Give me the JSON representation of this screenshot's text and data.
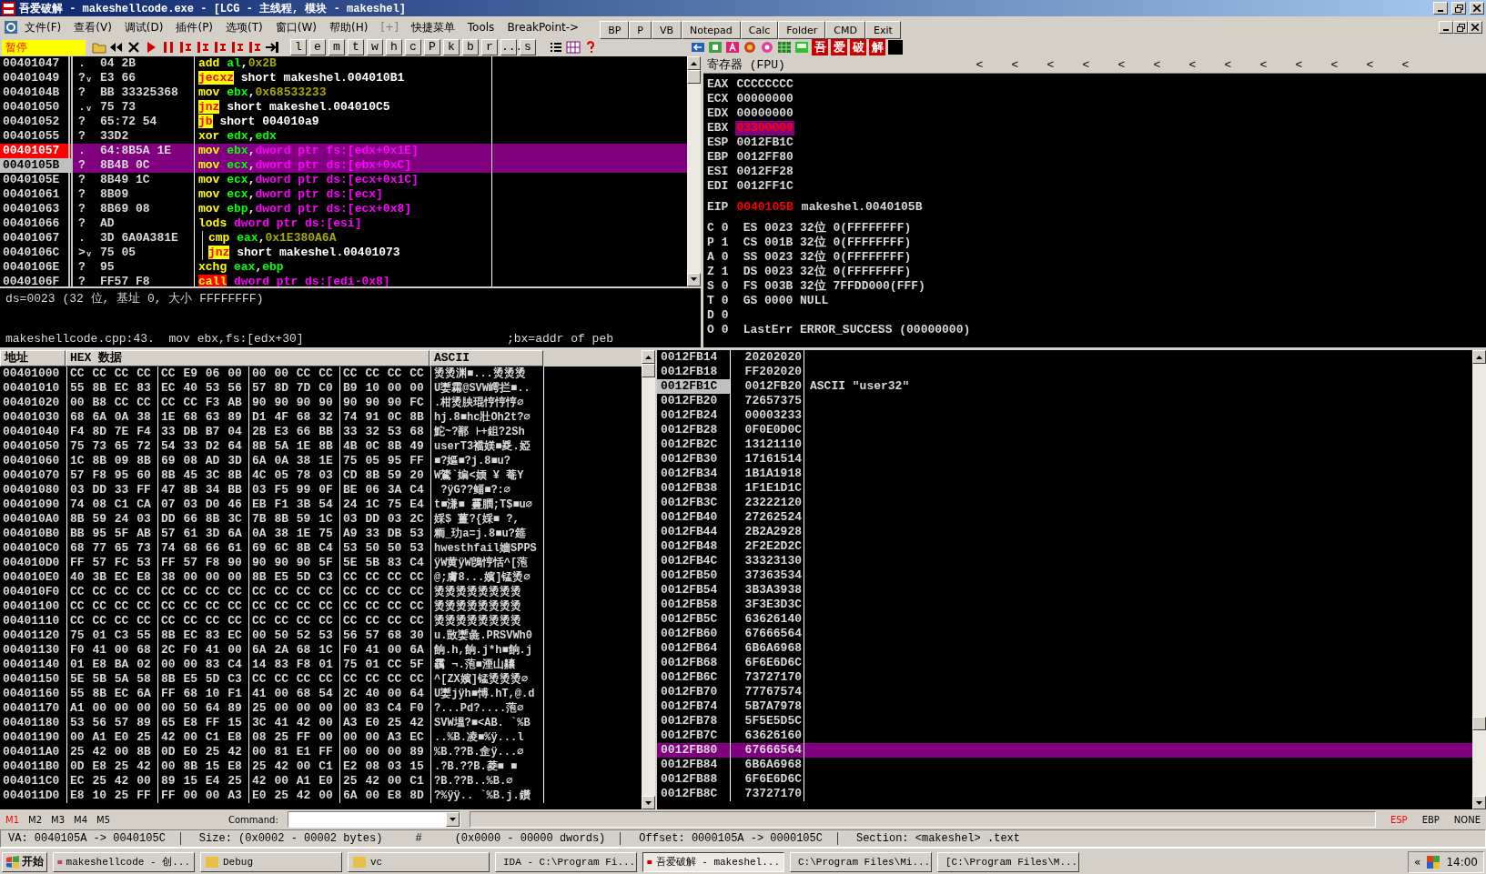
{
  "window": {
    "title": "吾爱破解 - makeshellcode.exe - [LCG - 主线程, 模块 - makeshel]"
  },
  "menu": [
    {
      "label": "文件(F)",
      "disabled": false
    },
    {
      "label": "查看(V)",
      "disabled": false
    },
    {
      "label": "调试(D)",
      "disabled": false
    },
    {
      "label": "插件(P)",
      "disabled": false
    },
    {
      "label": "选项(T)",
      "disabled": false
    },
    {
      "label": "窗口(W)",
      "disabled": false
    },
    {
      "label": "帮助(H)",
      "disabled": false
    },
    {
      "label": "[+]",
      "disabled": true
    },
    {
      "label": "快捷菜单",
      "disabled": false
    },
    {
      "label": "Tools",
      "disabled": false
    },
    {
      "label": "BreakPoint->",
      "disabled": false
    }
  ],
  "quick_buttons": [
    "BP",
    "P",
    "VB",
    "Notepad",
    "Calc",
    "Folder",
    "CMD",
    "Exit"
  ],
  "toolbar": {
    "status": "暂停",
    "letter_buttons": [
      "l",
      "e",
      "m",
      "t",
      "w",
      "h",
      "c",
      "P",
      "k",
      "b",
      "r",
      "...",
      "s"
    ],
    "plugin_chars": [
      "吾",
      "爱",
      "破",
      "解"
    ]
  },
  "disassembly": {
    "rows": [
      {
        "address": "00401047",
        "marker": ".",
        "hex": "04 2B",
        "ins": [
          {
            "kind": "mn",
            "text": "add "
          },
          {
            "kind": "reg",
            "text": "al"
          },
          {
            "kind": "pl",
            "text": ","
          },
          {
            "kind": "imm",
            "text": "0x2B"
          }
        ],
        "selected": false,
        "breakpoint": false,
        "current": false,
        "bracket": false
      },
      {
        "address": "00401049",
        "marker": "?ᵥ",
        "hex": "E3 66",
        "ins": [
          {
            "kind": "jmp",
            "text": "jecxz"
          },
          {
            "kind": "pl",
            "text": " short makeshel.004010B1"
          }
        ],
        "selected": false,
        "breakpoint": false,
        "current": false,
        "bracket": false
      },
      {
        "address": "0040104B",
        "marker": "?",
        "hex": "BB 33325368",
        "ins": [
          {
            "kind": "mn",
            "text": "mov "
          },
          {
            "kind": "reg",
            "text": "ebx"
          },
          {
            "kind": "pl",
            "text": ","
          },
          {
            "kind": "imm",
            "text": "0x68533233"
          }
        ],
        "selected": false,
        "breakpoint": false,
        "current": false,
        "bracket": false
      },
      {
        "address": "00401050",
        "marker": ".ᵥ",
        "hex": "75 73",
        "ins": [
          {
            "kind": "jmp",
            "text": "jnz"
          },
          {
            "kind": "pl",
            "text": " short makeshel.004010C5"
          }
        ],
        "selected": false,
        "breakpoint": false,
        "current": false,
        "bracket": false
      },
      {
        "address": "00401052",
        "marker": "?",
        "hex": "65:72 54",
        "ins": [
          {
            "kind": "jmp",
            "text": "jb"
          },
          {
            "kind": "pl",
            "text": " short 004010a9"
          }
        ],
        "selected": false,
        "breakpoint": false,
        "current": false,
        "bracket": false
      },
      {
        "address": "00401055",
        "marker": "?",
        "hex": "33D2",
        "ins": [
          {
            "kind": "mn",
            "text": "xor "
          },
          {
            "kind": "reg",
            "text": "edx"
          },
          {
            "kind": "pl",
            "text": ","
          },
          {
            "kind": "reg",
            "text": "edx"
          }
        ],
        "selected": false,
        "breakpoint": false,
        "current": false,
        "bracket": false
      },
      {
        "address": "00401057",
        "marker": ".",
        "hex": "64:8B5A 1E",
        "ins": [
          {
            "kind": "mn",
            "text": "mov "
          },
          {
            "kind": "reg",
            "text": "ebx"
          },
          {
            "kind": "pl",
            "text": ","
          },
          {
            "kind": "mem",
            "text": "dword ptr fs:[edx+0x1E]"
          }
        ],
        "selected": true,
        "breakpoint": true,
        "current": false,
        "bracket": false
      },
      {
        "address": "0040105B",
        "marker": "?",
        "hex": "8B4B 0C",
        "ins": [
          {
            "kind": "mn",
            "text": "mov "
          },
          {
            "kind": "reg",
            "text": "ecx"
          },
          {
            "kind": "pl",
            "text": ","
          },
          {
            "kind": "mem",
            "text": "dword ptr ds:[ebx+0xC]"
          }
        ],
        "selected": true,
        "breakpoint": false,
        "current": true,
        "bracket": false
      },
      {
        "address": "0040105E",
        "marker": "?",
        "hex": "8B49 1C",
        "ins": [
          {
            "kind": "mn",
            "text": "mov "
          },
          {
            "kind": "reg",
            "text": "ecx"
          },
          {
            "kind": "pl",
            "text": ","
          },
          {
            "kind": "mem",
            "text": "dword ptr ds:[ecx+0x1C]"
          }
        ],
        "selected": false,
        "breakpoint": false,
        "current": false,
        "bracket": false
      },
      {
        "address": "00401061",
        "marker": "?",
        "hex": "8B09",
        "ins": [
          {
            "kind": "mn",
            "text": "mov "
          },
          {
            "kind": "reg",
            "text": "ecx"
          },
          {
            "kind": "pl",
            "text": ","
          },
          {
            "kind": "mem",
            "text": "dword ptr ds:[ecx]"
          }
        ],
        "selected": false,
        "breakpoint": false,
        "current": false,
        "bracket": false
      },
      {
        "address": "00401063",
        "marker": "?",
        "hex": "8B69 08",
        "ins": [
          {
            "kind": "mn",
            "text": "mov "
          },
          {
            "kind": "reg",
            "text": "ebp"
          },
          {
            "kind": "pl",
            "text": ","
          },
          {
            "kind": "mem",
            "text": "dword ptr ds:[ecx+0x8]"
          }
        ],
        "selected": false,
        "breakpoint": false,
        "current": false,
        "bracket": false
      },
      {
        "address": "00401066",
        "marker": "?",
        "hex": "AD",
        "ins": [
          {
            "kind": "mn",
            "text": "lods "
          },
          {
            "kind": "mem",
            "text": "dword ptr ds:[esi]"
          }
        ],
        "selected": false,
        "breakpoint": false,
        "current": false,
        "bracket": false
      },
      {
        "address": "00401067",
        "marker": ".",
        "hex": "3D 6A0A381E",
        "ins": [
          {
            "kind": "mn",
            "text": "cmp "
          },
          {
            "kind": "reg",
            "text": "eax"
          },
          {
            "kind": "pl",
            "text": ","
          },
          {
            "kind": "imm",
            "text": "0x1E380A6A"
          }
        ],
        "selected": false,
        "breakpoint": false,
        "current": false,
        "bracket": true
      },
      {
        "address": "0040106C",
        "marker": ">ᵥ",
        "hex": "75 05",
        "ins": [
          {
            "kind": "jmp",
            "text": "jnz"
          },
          {
            "kind": "pl",
            "text": " short makeshel.00401073"
          }
        ],
        "selected": false,
        "breakpoint": false,
        "current": false,
        "bracket": true
      },
      {
        "address": "0040106E",
        "marker": "?",
        "hex": "95",
        "ins": [
          {
            "kind": "mn",
            "text": "xchg "
          },
          {
            "kind": "reg",
            "text": "eax"
          },
          {
            "kind": "pl",
            "text": ","
          },
          {
            "kind": "reg",
            "text": "ebp"
          }
        ],
        "selected": false,
        "breakpoint": false,
        "current": false,
        "bracket": false
      },
      {
        "address": "0040106F",
        "marker": "?",
        "hex": "FF57 F8",
        "ins": [
          {
            "kind": "call",
            "text": "call"
          },
          {
            "kind": "mem",
            "text": " dword ptr ds:[edi-0x8]"
          }
        ],
        "selected": false,
        "breakpoint": false,
        "current": false,
        "bracket": false
      }
    ]
  },
  "info": {
    "lines": [
      "ds=0023 (32 位, 基址 0, 大小 FFFFFFFF)"
    ],
    "source": "makeshellcode.cpp:43.  mov ebx,fs:[edx+30]",
    "comment": ";bx=addr of peb"
  },
  "registers": {
    "title": "寄存器 (FPU)",
    "nav_arrows": [
      "<",
      "<",
      "<",
      "<",
      "<",
      "<",
      "<",
      "<",
      "<",
      "<",
      "<",
      "<",
      "<"
    ],
    "general": [
      {
        "name": "EAX",
        "value": "CCCCCCCC",
        "changed": false,
        "selected": false
      },
      {
        "name": "ECX",
        "value": "00000000",
        "changed": false,
        "selected": false
      },
      {
        "name": "EDX",
        "value": "00000000",
        "changed": false,
        "selected": false
      },
      {
        "name": "EBX",
        "value": "03300000",
        "changed": true,
        "selected": true
      },
      {
        "name": "ESP",
        "value": "0012FB1C",
        "changed": false,
        "selected": false
      },
      {
        "name": "EBP",
        "value": "0012FF80",
        "changed": false,
        "selected": false
      },
      {
        "name": "ESI",
        "value": "0012FF28",
        "changed": false,
        "selected": false
      },
      {
        "name": "EDI",
        "value": "0012FF1C",
        "changed": false,
        "selected": false
      }
    ],
    "eip": {
      "name": "EIP",
      "value": "0040105B",
      "changed": true,
      "comment": "makeshel.0040105B"
    },
    "flags": [
      {
        "flag": "C",
        "value": "0",
        "detail": "ES 0023 32位 0(FFFFFFFF)"
      },
      {
        "flag": "P",
        "value": "1",
        "detail": "CS 001B 32位 0(FFFFFFFF)"
      },
      {
        "flag": "A",
        "value": "0",
        "detail": "SS 0023 32位 0(FFFFFFFF)"
      },
      {
        "flag": "Z",
        "value": "1",
        "detail": "DS 0023 32位 0(FFFFFFFF)"
      },
      {
        "flag": "S",
        "value": "0",
        "detail": "FS 003B 32位 7FFDD000(FFF)"
      },
      {
        "flag": "T",
        "value": "0",
        "detail": "GS 0000 NULL"
      },
      {
        "flag": "D",
        "value": "0"
      },
      {
        "flag": "O",
        "value": "0",
        "detail": "LastErr ERROR_SUCCESS (00000000)"
      }
    ]
  },
  "dump": {
    "columns": [
      "地址",
      "HEX 数据",
      "ASCII"
    ],
    "rows": [
      {
        "address": "00401000",
        "groups": [
          "CC CC CC CC",
          "CC E9 06 00",
          "00 00 CC CC",
          "CC CC CC CC"
        ],
        "ascii": "烫烫渊■...烫烫烫"
      },
      {
        "address": "00401010",
        "groups": [
          "55 8B EC 83",
          "EC 40 53 56",
          "57 8D 7D C0",
          "B9 10 00 00"
        ],
        "ascii": "U嬱霦@SVW嶀拦■.."
      },
      {
        "address": "00401020",
        "groups": [
          "00 B8 CC CC",
          "CC CC F3 AB",
          "90 90 90 90",
          "90 90 90 FC"
        ],
        "ascii": ".柑烫胦琨悙悙悙∅"
      },
      {
        "address": "00401030",
        "groups": [
          "68 6A 0A 38",
          "1E 68 63 89",
          "D1 4F 68 32",
          "74 91 0C 8B"
        ],
        "ascii": "hj.8■hc壯Oh2t?∅"
      },
      {
        "address": "00401040",
        "groups": [
          "F4 8D 7E F4",
          "33 DB B7 04",
          "2B E3 66 BB",
          "33 32 53 68"
        ],
        "ascii": "鮀~?鄯 ⊦+鉏?2Sh"
      },
      {
        "address": "00401050",
        "groups": [
          "75 73 65 72",
          "54 33 D2 64",
          "8B 5A 1E 8B",
          "4B 0C 8B 49"
        ],
        "ascii": "userT3襠媄■㚇.婭"
      },
      {
        "address": "00401060",
        "groups": [
          "1C 8B 09 8B",
          "69 08 AD 3D",
          "6A 0A 38 1E",
          "75 05 95 FF"
        ],
        "ascii": "■?嫗■?j.8■u?"
      },
      {
        "address": "00401070",
        "groups": [
          "57 F8 95 60",
          "8B 45 3C 8B",
          "4C 05 78 03",
          "CD 8B 59 20"
        ],
        "ascii": "W鷟`媥<媆 ¥ 菴Y"
      },
      {
        "address": "00401080",
        "groups": [
          "03 DD 33 FF",
          "47 8B 34 BB",
          "03 F5 99 0F",
          "BE 06 3A C4"
        ],
        "ascii": " ?ÿG??鲻■?:∅"
      },
      {
        "address": "00401090",
        "groups": [
          "74 08 C1 CA",
          "07 03 D0 46",
          "EB F1 3B 54",
          "24 1C 75 E4"
        ],
        "ascii": "t■溓■ 霻膶;T$■u∅"
      },
      {
        "address": "004010A0",
        "groups": [
          "8B 59 24 03",
          "DD 66 8B 3C",
          "7B 8B 59 1C",
          "03 DD 03 2C"
        ],
        "ascii": "婇$ 薑?{婇■ ?,"
      },
      {
        "address": "004010B0",
        "groups": [
          "BB 95 5F AB",
          "57 61 3D 6A",
          "0A 38 1E 75",
          "A9 33 DB 53"
        ],
        "ascii": "粫_玏a=j.8■u?筵"
      },
      {
        "address": "004010C0",
        "groups": [
          "68 77 65 73",
          "74 68 66 61",
          "69 6C 8B C4",
          "53 50 50 53"
        ],
        "ascii": "hwesthfail嬙SPPS"
      },
      {
        "address": "004010D0",
        "groups": [
          "FF 57 FC 53",
          "FF 57 F8 90",
          "90 90 90 5F",
          "5E 5B 83 C4"
        ],
        "ascii": "ÿW黄ÿW鵖悙恬^[萢"
      },
      {
        "address": "004010E0",
        "groups": [
          "40 3B EC E8",
          "38 00 00 00",
          "8B E5 5D C3",
          "CC CC CC CC"
        ],
        "ascii": "@;膚8...嬪]锰烫∅"
      },
      {
        "address": "004010F0",
        "groups": [
          "CC CC CC CC",
          "CC CC CC CC",
          "CC CC CC CC",
          "CC CC CC CC"
        ],
        "ascii": "烫烫烫烫烫烫烫烫"
      },
      {
        "address": "00401100",
        "groups": [
          "CC CC CC CC",
          "CC CC CC CC",
          "CC CC CC CC",
          "CC CC CC CC"
        ],
        "ascii": "烫烫烫烫烫烫烫烫"
      },
      {
        "address": "00401110",
        "groups": [
          "CC CC CC CC",
          "CC CC CC CC",
          "CC CC CC CC",
          "CC CC CC CC"
        ],
        "ascii": "烫烫烫烫烫烫烫烫"
      },
      {
        "address": "00401120",
        "groups": [
          "75 01 C3 55",
          "8B EC 83 EC",
          "00 50 52 53",
          "56 57 68 30"
        ],
        "ascii": "u.敳嬱彘.PRSVWh0"
      },
      {
        "address": "00401130",
        "groups": [
          "F0 41 00 68",
          "2C F0 41 00",
          "6A 2A 68 1C",
          "F0 41 00 6A"
        ],
        "ascii": "餉.h,餉.j*h■餉.j"
      },
      {
        "address": "00401140",
        "groups": [
          "01 E8 BA 02",
          "00 00 83 C4",
          "14 83 F8 01",
          "75 01 CC 5F"
        ],
        "ascii": "靏 ¬.萢■湮山齉"
      },
      {
        "address": "00401150",
        "groups": [
          "5E 5B 5A 58",
          "8B E5 5D C3",
          "CC CC CC CC",
          "CC CC CC CC"
        ],
        "ascii": "^[ZX嬪]锰烫烫烫∅"
      },
      {
        "address": "00401160",
        "groups": [
          "55 8B EC 6A",
          "FF 68 10 F1",
          "41 00 68 54",
          "2C 40 00 64"
        ],
        "ascii": "U嬱jÿh■愽.hT,@.d"
      },
      {
        "address": "00401170",
        "groups": [
          "A1 00 00 00",
          "00 50 64 89",
          "25 00 00 00",
          "00 83 C4 F0"
        ],
        "ascii": "?...Pd?....萢∅"
      },
      {
        "address": "00401180",
        "groups": [
          "53 56 57 89",
          "65 E8 FF 15",
          "3C 41 42 00",
          "A3 E0 25 42"
        ],
        "ascii": "SVW塭?■<AB. `%B"
      },
      {
        "address": "00401190",
        "groups": [
          "00 A1 E0 25",
          "42 00 C1 E8",
          "08 25 FF 00",
          "00 00 A3 EC"
        ],
        "ascii": "..%B.凌■%ÿ...l"
      },
      {
        "address": "004011A0",
        "groups": [
          "25 42 00 8B",
          "0D E0 25 42",
          "00 81 E1 FF",
          "00 00 00 89"
        ],
        "ascii": "%B.??B.佱ÿ...∅"
      },
      {
        "address": "004011B0",
        "groups": [
          "0D E8 25 42",
          "00 8B 15 E8",
          "25 42 00 C1",
          "E2 08 03 15"
        ],
        "ascii": ".?B.??B.菱■ ■"
      },
      {
        "address": "004011C0",
        "groups": [
          "EC 25 42 00",
          "89 15 E4 25",
          "42 00 A1 E0",
          "25 42 00 C1"
        ],
        "ascii": "?B.??B..%B.∅"
      },
      {
        "address": "004011D0",
        "groups": [
          "E8 10 25 FF",
          "FF 00 00 A3",
          "E0 25 42 00",
          "6A 00 E8 8D"
        ],
        "ascii": "?%ÿÿ.. `%B.j.鑽"
      }
    ]
  },
  "stack": {
    "rows": [
      {
        "address": "0012FB14",
        "value": "20202020",
        "current": false,
        "selected": false
      },
      {
        "address": "0012FB18",
        "value": "FF202020",
        "current": false,
        "selected": false
      },
      {
        "address": "0012FB1C",
        "value": "0012FB20",
        "comment": "ASCII \"user32\"",
        "current": true,
        "selected": false
      },
      {
        "address": "0012FB20",
        "value": "72657375",
        "current": false,
        "selected": false
      },
      {
        "address": "0012FB24",
        "value": "00003233",
        "current": false,
        "selected": false
      },
      {
        "address": "0012FB28",
        "value": "0F0E0D0C",
        "current": false,
        "selected": false
      },
      {
        "address": "0012FB2C",
        "value": "13121110",
        "current": false,
        "selected": false
      },
      {
        "address": "0012FB30",
        "value": "17161514",
        "current": false,
        "selected": false
      },
      {
        "address": "0012FB34",
        "value": "1B1A1918",
        "current": false,
        "selected": false
      },
      {
        "address": "0012FB38",
        "value": "1F1E1D1C",
        "current": false,
        "selected": false
      },
      {
        "address": "0012FB3C",
        "value": "23222120",
        "current": false,
        "selected": false
      },
      {
        "address": "0012FB40",
        "value": "27262524",
        "current": false,
        "selected": false
      },
      {
        "address": "0012FB44",
        "value": "2B2A2928",
        "current": false,
        "selected": false
      },
      {
        "address": "0012FB48",
        "value": "2F2E2D2C",
        "current": false,
        "selected": false
      },
      {
        "address": "0012FB4C",
        "value": "33323130",
        "current": false,
        "selected": false
      },
      {
        "address": "0012FB50",
        "value": "37363534",
        "current": false,
        "selected": false
      },
      {
        "address": "0012FB54",
        "value": "3B3A3938",
        "current": false,
        "selected": false
      },
      {
        "address": "0012FB58",
        "value": "3F3E3D3C",
        "current": false,
        "selected": false
      },
      {
        "address": "0012FB5C",
        "value": "63626140",
        "current": false,
        "selected": false
      },
      {
        "address": "0012FB60",
        "value": "67666564",
        "current": false,
        "selected": false
      },
      {
        "address": "0012FB64",
        "value": "6B6A6968",
        "current": false,
        "selected": false
      },
      {
        "address": "0012FB68",
        "value": "6F6E6D6C",
        "current": false,
        "selected": false
      },
      {
        "address": "0012FB6C",
        "value": "73727170",
        "current": false,
        "selected": false
      },
      {
        "address": "0012FB70",
        "value": "77767574",
        "current": false,
        "selected": false
      },
      {
        "address": "0012FB74",
        "value": "5B7A7978",
        "current": false,
        "selected": false
      },
      {
        "address": "0012FB78",
        "value": "5F5E5D5C",
        "current": false,
        "selected": false
      },
      {
        "address": "0012FB7C",
        "value": "63626160",
        "current": false,
        "selected": false
      },
      {
        "address": "0012FB80",
        "value": "67666564",
        "current": false,
        "selected": true
      },
      {
        "address": "0012FB84",
        "value": "6B6A6968",
        "current": false,
        "selected": false
      },
      {
        "address": "0012FB88",
        "value": "6F6E6D6C",
        "current": false,
        "selected": false
      },
      {
        "address": "0012FB8C",
        "value": "73727170",
        "current": false,
        "selected": false
      }
    ]
  },
  "command_bar": {
    "markers": [
      {
        "label": "M1",
        "selected": true
      },
      {
        "label": "M2",
        "selected": false
      },
      {
        "label": "M3",
        "selected": false
      },
      {
        "label": "M4",
        "selected": false
      },
      {
        "label": "M5",
        "selected": false
      }
    ],
    "label": "Command:",
    "regs": [
      {
        "label": "ESP",
        "selected": true
      },
      {
        "label": "EBP",
        "selected": false
      },
      {
        "label": "NONE",
        "selected": false
      }
    ]
  },
  "status_bar": {
    "segments": [
      {
        "text": "VA: 0040105A -> 0040105C",
        "separated": true
      },
      {
        "text": "Size: (0x0002 - 00002 bytes)",
        "separated": false
      },
      {
        "text": "#",
        "separated": false
      },
      {
        "text": "(0x0000 - 00000 dwords)",
        "separated": true
      },
      {
        "text": "Offset: 0000105A -> 0000105C",
        "separated": true
      },
      {
        "text": "Section: <makeshel> .text",
        "separated": false
      }
    ]
  },
  "taskbar": {
    "start": "开始",
    "tasks": [
      {
        "label": "makeshellcode - 创...",
        "selected": false
      },
      {
        "label": "Debug",
        "selected": false
      },
      {
        "label": "vc",
        "selected": false
      },
      {
        "label": "IDA - C:\\Program Fi...",
        "selected": false
      },
      {
        "label": "吾爱破解 - makeshel...",
        "selected": true
      },
      {
        "label": "C:\\Program Files\\Mi...",
        "selected": false
      },
      {
        "label": "[C:\\Program Files\\M...",
        "selected": false
      }
    ],
    "tray_toggle": "«",
    "clock": "14:00"
  }
}
